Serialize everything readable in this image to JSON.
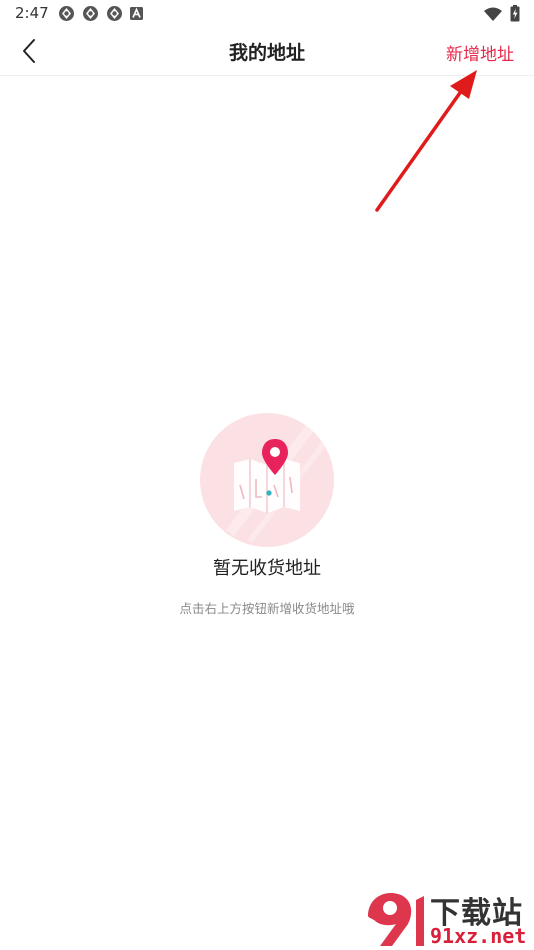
{
  "status_bar": {
    "time": "2:47",
    "left_icons": [
      "aperture-icon",
      "aperture-icon",
      "aperture-icon",
      "font-a-icon"
    ],
    "right_icons": [
      "wifi-icon",
      "battery-charging-icon"
    ]
  },
  "nav": {
    "back_icon": "chevron-left-icon",
    "title": "我的地址",
    "add_label": "新增地址"
  },
  "empty_state": {
    "icon": "map-pin-icon",
    "title": "暂无收货地址",
    "hint": "点击右上方按钮新增收货地址哦"
  },
  "watermark": {
    "text": "下载站",
    "url": "91xz.net"
  },
  "colors": {
    "accent": "#e8294b",
    "illustration_bg": "#fbe0e4",
    "pin": "#e8225a",
    "dot": "#2bb3c0",
    "arrow": "#e01b1b"
  }
}
